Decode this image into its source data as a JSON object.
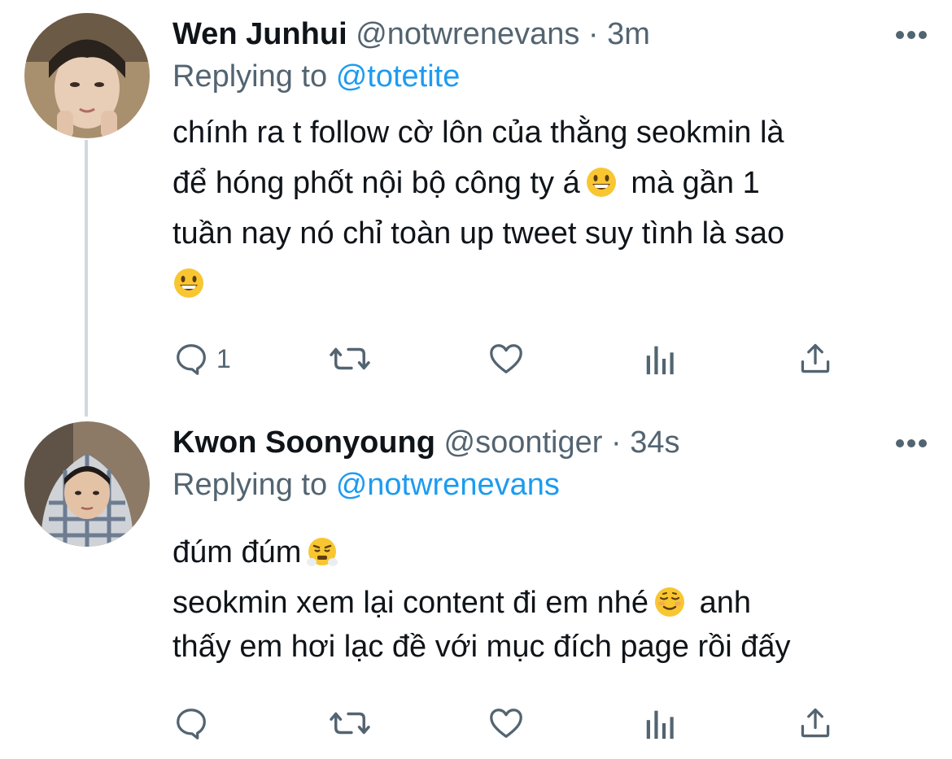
{
  "tweets": [
    {
      "name": "Wen Junhui",
      "handle": "@notwrenevans",
      "separator": "·",
      "time": "3m",
      "replying_label": "Replying to",
      "replying_to": "@totetite",
      "body_lines": [
        "chính ra t follow cờ lôn của thằng seokmin là",
        "để hóng phốt nội bộ công ty á",
        "mà gần 1",
        "tuần nay nó chỉ toàn up tweet suy tình là sao"
      ],
      "emojis": [
        "grinning-face-emoji",
        "grinning-face-emoji"
      ],
      "reply_count": "1"
    },
    {
      "name": "Kwon Soonyoung",
      "handle": "@soontiger",
      "separator": "·",
      "time": "34s",
      "replying_label": "Replying to",
      "replying_to": "@notwrenevans",
      "body_lines": [
        "đúm đúm",
        "seokmin xem lại content đi em nhé",
        "anh",
        "thấy em hơi lạc đề với mục đích page rồi đấy"
      ],
      "emojis": [
        "face-with-steam-emoji",
        "relieved-face-emoji"
      ],
      "reply_count": ""
    }
  ],
  "icons": [
    "reply-icon",
    "retweet-icon",
    "like-icon",
    "analytics-icon",
    "share-icon",
    "more-options-icon"
  ],
  "colors": {
    "text": "#0f1419",
    "muted": "#536471",
    "link": "#1d9bf0",
    "thread_line": "#cfd9de"
  }
}
